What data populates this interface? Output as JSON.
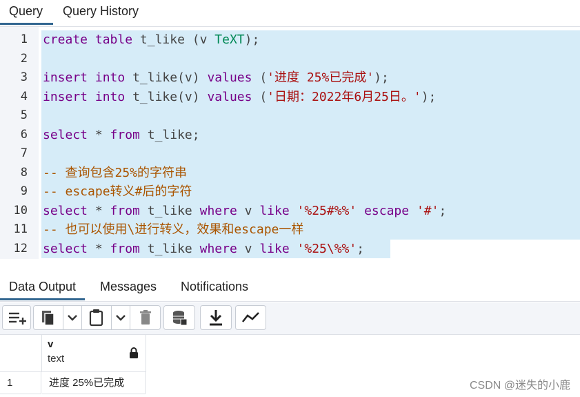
{
  "top_tabs": {
    "query": "Query",
    "history": "Query History"
  },
  "editor": {
    "lines": [
      {
        "n": "1",
        "tokens": [
          [
            "kw",
            "create"
          ],
          [
            "op",
            " "
          ],
          [
            "kw",
            "table"
          ],
          [
            "op",
            " t_like ("
          ],
          [
            "op",
            "v "
          ],
          [
            "typ",
            "TeXT"
          ],
          [
            "op",
            ");"
          ]
        ]
      },
      {
        "n": "2",
        "tokens": []
      },
      {
        "n": "3",
        "tokens": [
          [
            "kw",
            "insert"
          ],
          [
            "op",
            " "
          ],
          [
            "kw",
            "into"
          ],
          [
            "op",
            " t_like(v) "
          ],
          [
            "kw",
            "values"
          ],
          [
            "op",
            " ("
          ],
          [
            "str",
            "'进度 25%已完成'"
          ],
          [
            "op",
            ");"
          ]
        ]
      },
      {
        "n": "4",
        "tokens": [
          [
            "kw",
            "insert"
          ],
          [
            "op",
            " "
          ],
          [
            "kw",
            "into"
          ],
          [
            "op",
            " t_like(v) "
          ],
          [
            "kw",
            "values"
          ],
          [
            "op",
            " ("
          ],
          [
            "str",
            "'日期：2022年6月25日。'"
          ],
          [
            "op",
            ");"
          ]
        ]
      },
      {
        "n": "5",
        "tokens": []
      },
      {
        "n": "6",
        "tokens": [
          [
            "kw",
            "select"
          ],
          [
            "op",
            " * "
          ],
          [
            "kw",
            "from"
          ],
          [
            "op",
            " t_like;"
          ]
        ]
      },
      {
        "n": "7",
        "tokens": []
      },
      {
        "n": "8",
        "tokens": [
          [
            "cmt",
            "-- 查询包含25%的字符串"
          ]
        ]
      },
      {
        "n": "9",
        "tokens": [
          [
            "cmt",
            "-- escape转义#后的字符"
          ]
        ]
      },
      {
        "n": "10",
        "tokens": [
          [
            "kw",
            "select"
          ],
          [
            "op",
            " * "
          ],
          [
            "kw",
            "from"
          ],
          [
            "op",
            " t_like "
          ],
          [
            "kw",
            "where"
          ],
          [
            "op",
            " v "
          ],
          [
            "kw",
            "like"
          ],
          [
            "op",
            " "
          ],
          [
            "str",
            "'%25#%%'"
          ],
          [
            "op",
            " "
          ],
          [
            "kw",
            "escape"
          ],
          [
            "op",
            " "
          ],
          [
            "str",
            "'#'"
          ],
          [
            "op",
            ";"
          ]
        ]
      },
      {
        "n": "11",
        "tokens": [
          [
            "cmt",
            "-- 也可以使用\\进行转义，效果和escape一样"
          ]
        ]
      },
      {
        "n": "12",
        "tokens": [
          [
            "kw",
            "select"
          ],
          [
            "op",
            " * "
          ],
          [
            "kw",
            "from"
          ],
          [
            "op",
            " t_like "
          ],
          [
            "kw",
            "where"
          ],
          [
            "op",
            " v "
          ],
          [
            "kw",
            "like"
          ],
          [
            "op",
            " "
          ],
          [
            "str",
            "'%25\\%%'"
          ],
          [
            "op",
            ";"
          ]
        ]
      }
    ]
  },
  "bottom_tabs": {
    "data_output": "Data Output",
    "messages": "Messages",
    "notifications": "Notifications"
  },
  "toolbar": {
    "icons": [
      "add-row-icon",
      "copy-icon",
      "copy-dropdown-icon",
      "paste-icon",
      "paste-dropdown-icon",
      "delete-icon",
      "save-data-icon",
      "download-icon",
      "graph-icon"
    ]
  },
  "grid": {
    "column": {
      "name": "v",
      "type": "text"
    },
    "rows": [
      {
        "num": "1",
        "v": "进度 25%已完成"
      }
    ]
  },
  "watermark": "CSDN @迷失的小鹿",
  "colors": {
    "accent": "#326690",
    "keyword": "#770088",
    "string": "#aa1111",
    "comment": "#aa5500",
    "selection": "#d6ecf8"
  }
}
